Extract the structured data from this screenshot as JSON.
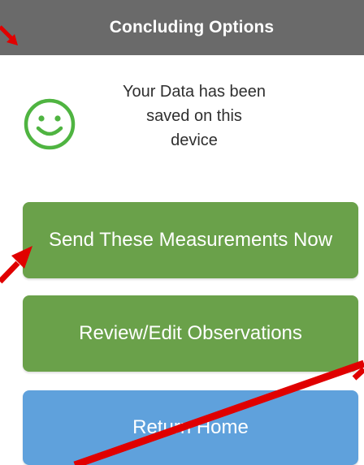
{
  "header": {
    "title": "Concluding Options"
  },
  "status": {
    "icon": "smiley-face-icon",
    "message": "Your Data has been\nsaved on this\ndevice"
  },
  "buttons": {
    "send": "Send These Measurements Now",
    "review": "Review/Edit Observations",
    "home": "Return Home"
  },
  "colors": {
    "header_bg": "#6a6a6a",
    "primary_green": "#6aa14a",
    "home_blue": "#5fa1dc",
    "smiley_green": "#4fb441",
    "annotation_red": "#e00000"
  }
}
